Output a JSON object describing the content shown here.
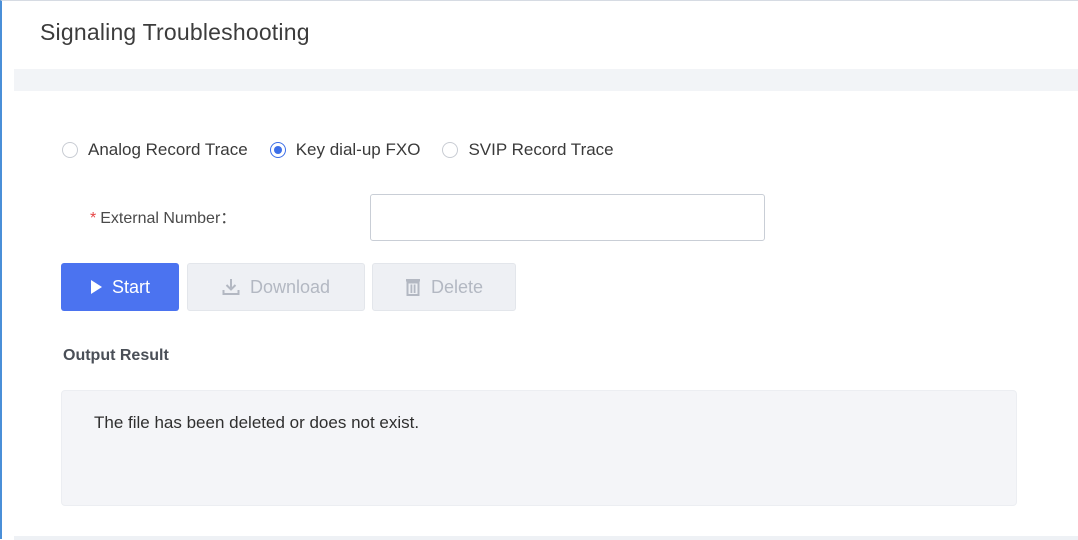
{
  "header": {
    "title": "Signaling Troubleshooting"
  },
  "trace_options": [
    {
      "label": "Analog Record Trace",
      "checked": false
    },
    {
      "label": "Key dial-up FXO",
      "checked": true
    },
    {
      "label": "SVIP Record Trace",
      "checked": false
    }
  ],
  "external_number": {
    "required_mark": "*",
    "label": "External Number：",
    "value": "",
    "placeholder": ""
  },
  "buttons": {
    "start": {
      "label": "Start",
      "icon": "play-icon",
      "enabled": true
    },
    "download": {
      "label": "Download",
      "icon": "download-icon",
      "enabled": false
    },
    "delete": {
      "label": "Delete",
      "icon": "trash-icon",
      "enabled": false
    }
  },
  "output": {
    "title": "Output Result",
    "message": "The file has been deleted or does not exist."
  },
  "colors": {
    "accent": "#4b73f0",
    "disabled_bg": "#eef0f4",
    "disabled_text": "#b3b8c2",
    "required": "#e64545"
  }
}
